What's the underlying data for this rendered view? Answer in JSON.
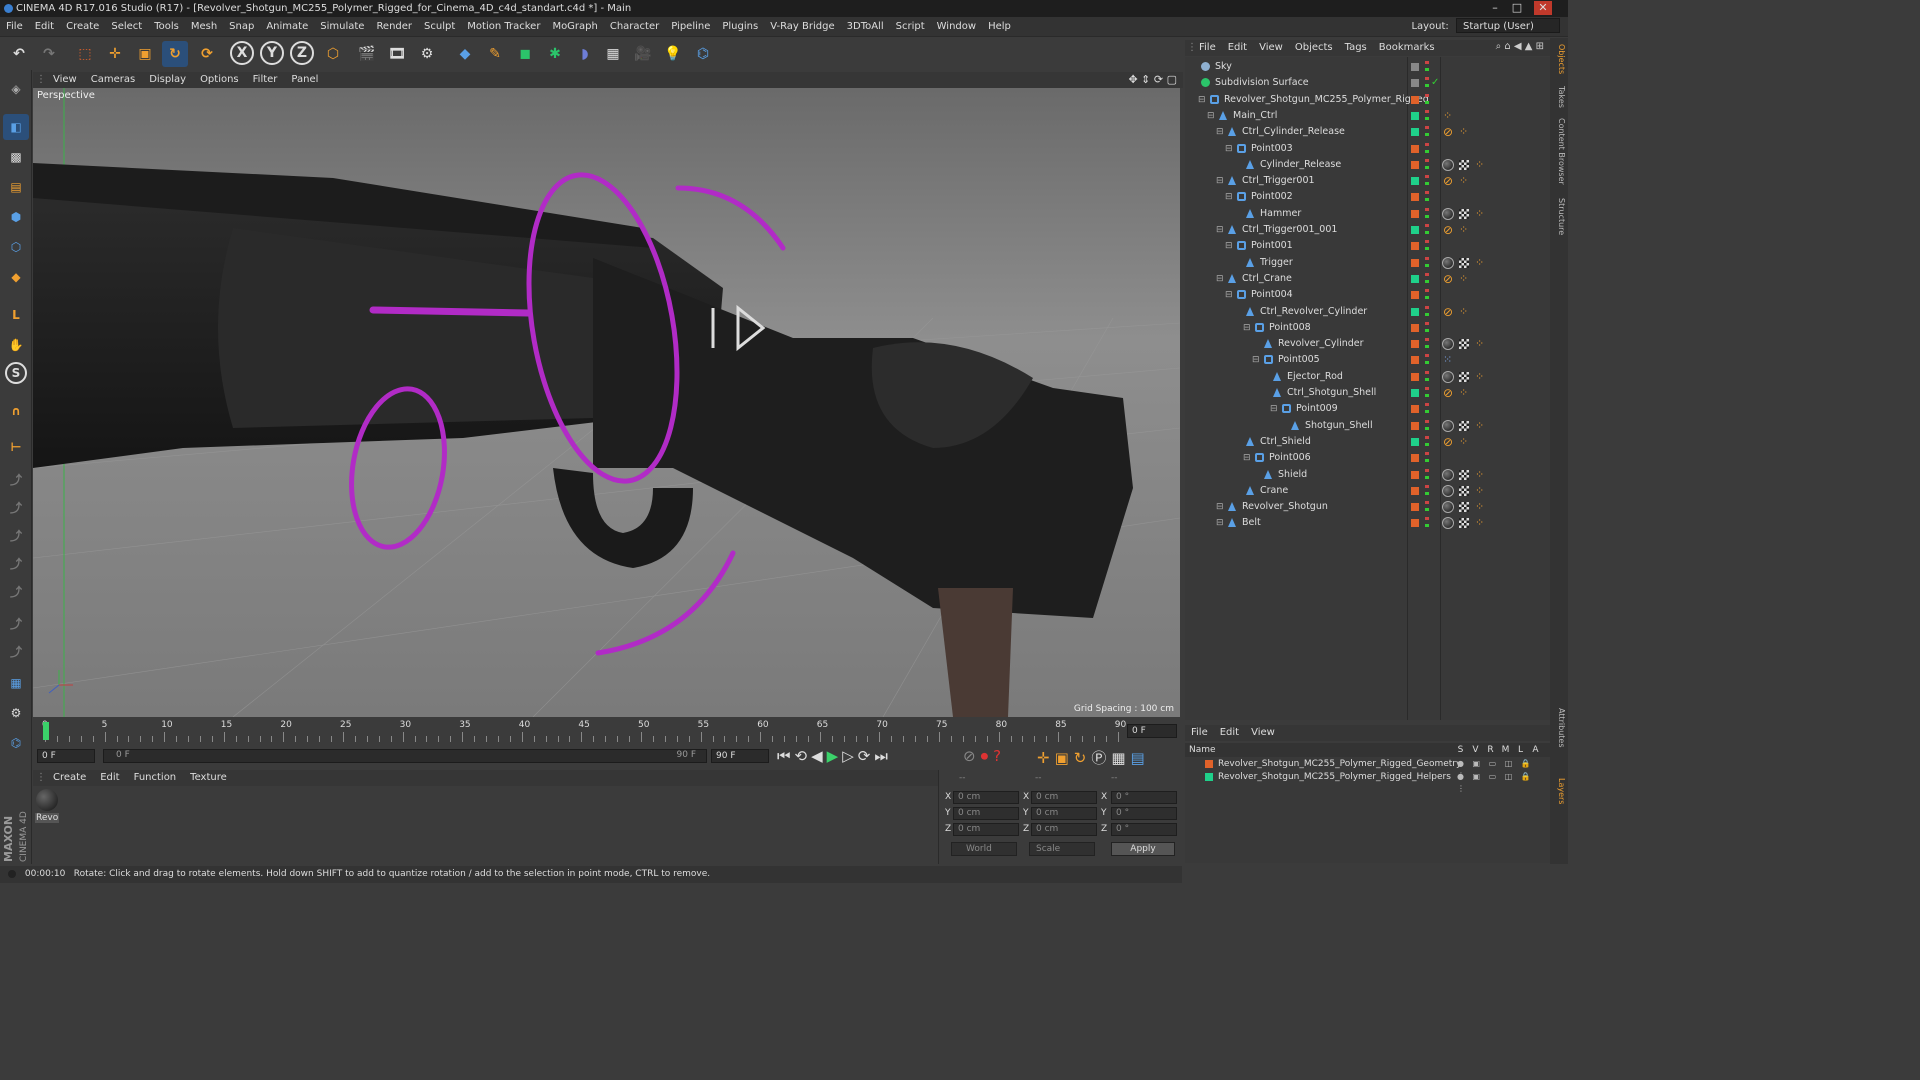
{
  "window": {
    "title": "CINEMA 4D R17.016 Studio (R17) - [Revolver_Shotgun_MC255_Polymer_Rigged_for_Cinema_4D_c4d_standart.c4d *] - Main",
    "controls": [
      "–",
      "□",
      "✕"
    ]
  },
  "menubar": {
    "items": [
      "File",
      "Edit",
      "Create",
      "Select",
      "Tools",
      "Mesh",
      "Snap",
      "Animate",
      "Simulate",
      "Render",
      "Sculpt",
      "Motion Tracker",
      "MoGraph",
      "Character",
      "Pipeline",
      "Plugins",
      "V-Ray Bridge",
      "3DToAll",
      "Script",
      "Window",
      "Help"
    ],
    "layout_label": "Layout:",
    "layout_value": "Startup (User)"
  },
  "toolbar": {
    "axis_x": "X",
    "axis_y": "Y",
    "axis_z": "Z"
  },
  "viewport": {
    "menu": [
      "View",
      "Cameras",
      "Display",
      "Options",
      "Filter",
      "Panel"
    ],
    "label": "Perspective",
    "grid_spacing": "Grid Spacing : 100 cm"
  },
  "timeline": {
    "ticks": [
      "0",
      "5",
      "10",
      "15",
      "20",
      "25",
      "30",
      "35",
      "40",
      "45",
      "50",
      "55",
      "60",
      "65",
      "70",
      "75",
      "80",
      "85",
      "90"
    ],
    "current_frame": "0 F",
    "start_field": "0 F",
    "range_start": "0 F",
    "range_end": "90 F",
    "end_field": "90 F"
  },
  "materials": {
    "menu": [
      "Create",
      "Edit",
      "Function",
      "Texture"
    ],
    "items": [
      {
        "label": "Revo"
      }
    ]
  },
  "coordinates": {
    "header": [
      "--",
      "--",
      "--"
    ],
    "rows": [
      {
        "axis": "X",
        "pos": "0 cm",
        "size_axis": "X",
        "size": "0 cm",
        "rot_axis": "X",
        "rot": "0 °"
      },
      {
        "axis": "Y",
        "pos": "0 cm",
        "size_axis": "Y",
        "size": "0 cm",
        "rot_axis": "Y",
        "rot": "0 °"
      },
      {
        "axis": "Z",
        "pos": "0 cm",
        "size_axis": "Z",
        "size": "0 cm",
        "rot_axis": "Z",
        "rot": "0 °"
      }
    ],
    "mode": "World",
    "type": "Scale",
    "apply": "Apply"
  },
  "status": {
    "time": "00:00:10",
    "message": "Rotate: Click and drag to rotate elements. Hold down SHIFT to add to quantize rotation / add to the selection in point mode, CTRL to remove."
  },
  "object_manager": {
    "menu": [
      "File",
      "Edit",
      "View",
      "Objects",
      "Tags",
      "Bookmarks"
    ],
    "objects": [
      {
        "name": "Sky",
        "depth": 0,
        "type": "sky",
        "color": "#888888",
        "tags": ""
      },
      {
        "name": "Subdivision Surface",
        "depth": 0,
        "type": "subdiv",
        "color": "#888888",
        "tags": ""
      },
      {
        "name": "Revolver_Shotgun_MC255_Polymer_Rigged",
        "depth": 1,
        "type": "null",
        "color": "#e0622a",
        "tags": ""
      },
      {
        "name": "Main_Ctrl",
        "depth": 2,
        "type": "joint",
        "color": "#1fd08a",
        "tags": "dots"
      },
      {
        "name": "Ctrl_Cylinder_Release",
        "depth": 3,
        "type": "joint",
        "color": "#1fd08a",
        "tags": "ik"
      },
      {
        "name": "Point003",
        "depth": 4,
        "type": "null",
        "color": "#e0622a",
        "tags": ""
      },
      {
        "name": "Cylinder_Release",
        "depth": 5,
        "type": "joint",
        "color": "#e0622a",
        "tags": "mat"
      },
      {
        "name": "Ctrl_Trigger001",
        "depth": 3,
        "type": "joint",
        "color": "#1fd08a",
        "tags": "ik"
      },
      {
        "name": "Point002",
        "depth": 4,
        "type": "null",
        "color": "#e0622a",
        "tags": ""
      },
      {
        "name": "Hammer",
        "depth": 5,
        "type": "joint",
        "color": "#e0622a",
        "tags": "mat"
      },
      {
        "name": "Ctrl_Trigger001_001",
        "depth": 3,
        "type": "joint",
        "color": "#1fd08a",
        "tags": "ik"
      },
      {
        "name": "Point001",
        "depth": 4,
        "type": "null",
        "color": "#e0622a",
        "tags": ""
      },
      {
        "name": "Trigger",
        "depth": 5,
        "type": "joint",
        "color": "#e0622a",
        "tags": "mat"
      },
      {
        "name": "Ctrl_Crane",
        "depth": 3,
        "type": "joint",
        "color": "#1fd08a",
        "tags": "ik"
      },
      {
        "name": "Point004",
        "depth": 4,
        "type": "null",
        "color": "#e0622a",
        "tags": ""
      },
      {
        "name": "Ctrl_Revolver_Cylinder",
        "depth": 5,
        "type": "joint",
        "color": "#1fd08a",
        "tags": "ik"
      },
      {
        "name": "Point008",
        "depth": 6,
        "type": "null",
        "color": "#e0622a",
        "tags": ""
      },
      {
        "name": "Revolver_Cylinder",
        "depth": 7,
        "type": "joint",
        "color": "#e0622a",
        "tags": "mat"
      },
      {
        "name": "Point005",
        "depth": 7,
        "type": "null",
        "color": "#e0622a",
        "tags": "grid"
      },
      {
        "name": "Ejector_Rod",
        "depth": 8,
        "type": "joint",
        "color": "#e0622a",
        "tags": "mat"
      },
      {
        "name": "Ctrl_Shotgun_Shell",
        "depth": 8,
        "type": "joint",
        "color": "#1fd08a",
        "tags": "ik"
      },
      {
        "name": "Point009",
        "depth": 9,
        "type": "null",
        "color": "#e0622a",
        "tags": ""
      },
      {
        "name": "Shotgun_Shell",
        "depth": 10,
        "type": "joint",
        "color": "#e0622a",
        "tags": "mat"
      },
      {
        "name": "Ctrl_Shield",
        "depth": 5,
        "type": "joint",
        "color": "#1fd08a",
        "tags": "ik"
      },
      {
        "name": "Point006",
        "depth": 6,
        "type": "null",
        "color": "#e0622a",
        "tags": ""
      },
      {
        "name": "Shield",
        "depth": 7,
        "type": "joint",
        "color": "#e0622a",
        "tags": "mat"
      },
      {
        "name": "Crane",
        "depth": 5,
        "type": "joint",
        "color": "#e0622a",
        "tags": "mat"
      },
      {
        "name": "Revolver_Shotgun",
        "depth": 3,
        "type": "joint",
        "color": "#e0622a",
        "tags": "mat"
      },
      {
        "name": "Belt",
        "depth": 3,
        "type": "joint",
        "color": "#e0622a",
        "tags": "mat"
      }
    ]
  },
  "layer_manager": {
    "menu": [
      "File",
      "Edit",
      "View"
    ],
    "header_name": "Name",
    "header_flags": [
      "S",
      "V",
      "R",
      "M",
      "L",
      "A"
    ],
    "layers": [
      {
        "name": "Revolver_Shotgun_MC255_Polymer_Rigged_Geometry",
        "color": "#e0622a"
      },
      {
        "name": "Revolver_Shotgun_MC255_Polymer_Rigged_Helpers",
        "color": "#1fd08a"
      }
    ]
  },
  "right_tabs": [
    "Objects",
    "Takes",
    "Content Browser",
    "Structure",
    "Attributes",
    "Layers"
  ],
  "branding": {
    "vendor": "MAXON",
    "product": "CINEMA 4D"
  },
  "colors": {
    "accent_blue": "#3a7fd0",
    "control_magenta": "#b12bc6",
    "green_tag": "#1fd08a",
    "orange_tag": "#e0622a"
  }
}
